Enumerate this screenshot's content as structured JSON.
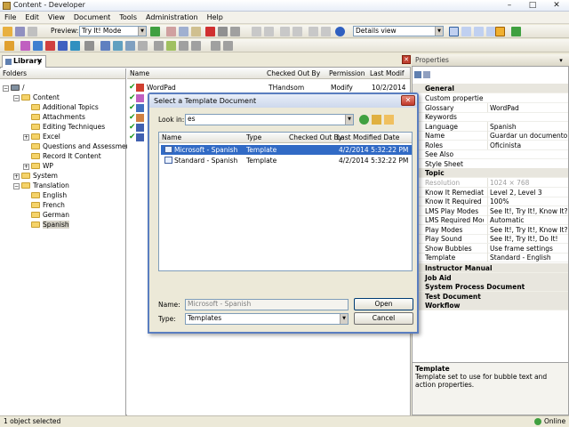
{
  "window": {
    "title": "Content - Developer",
    "min": "–",
    "max": "□",
    "close": "✕"
  },
  "menu": [
    "File",
    "Edit",
    "View",
    "Document",
    "Tools",
    "Administration",
    "Help"
  ],
  "toolbar": {
    "preview_label": "Preview:",
    "preview_mode": "Try It! Mode",
    "view_mode": "Details view"
  },
  "library": {
    "tab_label": "Library",
    "tab_close": "✕",
    "folders_header": "Folders",
    "tree": [
      "/",
      "Content",
      "Additional Topics",
      "Attachments",
      "Editing Techniques",
      "Excel",
      "Questions and Assessments",
      "Record It Content",
      "WP",
      "System",
      "Translation",
      "English",
      "French",
      "German",
      "Spanish"
    ],
    "columns": [
      "Name",
      "Checked Out By",
      "Permission",
      "Last Modif"
    ],
    "rows": [
      {
        "name": "WordPad",
        "checked_out_by": "THandsom",
        "permission": "Modify",
        "last_modified": "10/2/2014"
      }
    ]
  },
  "dialog": {
    "title": "Select a Template Document",
    "close": "✕",
    "look_in_label": "Look in:",
    "look_in_value": "es",
    "columns": [
      "Name",
      "Type",
      "Checked Out By",
      "Last Modified Date"
    ],
    "rows": [
      {
        "name": "Microsoft - Spanish",
        "type": "Template",
        "checked_out_by": "",
        "modified": "4/2/2014 5:32:22 PM"
      },
      {
        "name": "Standard - Spanish",
        "type": "Template",
        "checked_out_by": "",
        "modified": "4/2/2014 5:32:22 PM"
      }
    ],
    "name_label": "Name:",
    "name_value": "Microsoft - Spanish",
    "type_label": "Type:",
    "type_value": "Templates",
    "open": "Open",
    "cancel": "Cancel"
  },
  "properties": {
    "title": "Properties",
    "general_header": "General",
    "general": [
      {
        "k": "Custom properties",
        "v": ""
      },
      {
        "k": "Glossary",
        "v": "WordPad"
      },
      {
        "k": "Keywords",
        "v": ""
      },
      {
        "k": "Language",
        "v": "Spanish"
      },
      {
        "k": "Name",
        "v": "Guardar un documento co..."
      },
      {
        "k": "Roles",
        "v": "Oficinista"
      },
      {
        "k": "See Also",
        "v": ""
      },
      {
        "k": "Style Sheet",
        "v": ""
      }
    ],
    "topic_header": "Topic",
    "topic": [
      {
        "k": "Resolution",
        "v": "1024 × 768"
      },
      {
        "k": "Know It Remediation",
        "v": "Level 2, Level 3"
      },
      {
        "k": "Know It Required %",
        "v": "100%"
      },
      {
        "k": "LMS Play Modes",
        "v": "See It!, Try It!, Know It?"
      },
      {
        "k": "LMS Required Mode",
        "v": "Automatic"
      },
      {
        "k": "Play Modes",
        "v": "See It!, Try It!, Know It?, ..."
      },
      {
        "k": "Play Sound",
        "v": "See It!, Try It!, Do It!"
      },
      {
        "k": "Show Bubbles",
        "v": "Use frame settings"
      },
      {
        "k": "Template",
        "v": "Standard - English"
      }
    ],
    "groups": [
      "Instructor Manual",
      "Job Aid",
      "System Process Document",
      "Test Document",
      "Workflow"
    ],
    "desc_title": "Template",
    "desc_text": "Template set to use for bubble text and action properties."
  },
  "status": {
    "left": "1 object selected",
    "right": "Online"
  }
}
